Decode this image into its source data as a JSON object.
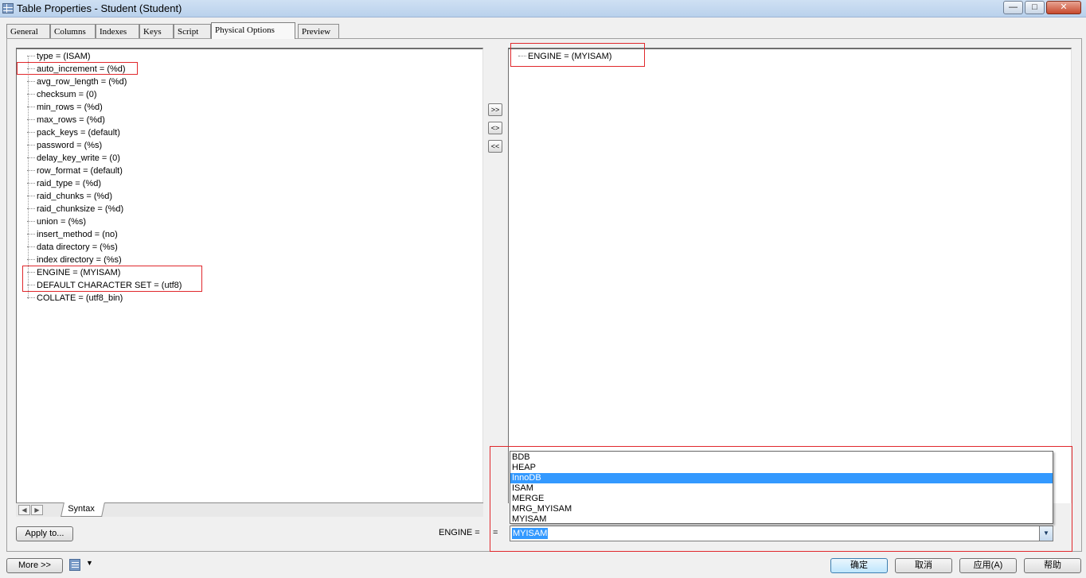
{
  "window": {
    "title": "Table Properties - Student (Student)",
    "minimize": "—",
    "maximize": "□",
    "close": "✕"
  },
  "tabs": [
    "General",
    "Columns",
    "Indexes",
    "Keys",
    "Script",
    "Physical Options",
    "Preview"
  ],
  "active_tab": "Physical Options",
  "left_tree": [
    "type = (ISAM)",
    "auto_increment = (%d)",
    "avg_row_length = (%d)",
    "checksum = (0)",
    "min_rows = (%d)",
    "max_rows = (%d)",
    "pack_keys = (default)",
    "password = (%s)",
    "delay_key_write = (0)",
    "row_format = (default)",
    "raid_type = (%d)",
    "raid_chunks = (%d)",
    "raid_chunksize = (%d)",
    "union = (%s)",
    "insert_method = (no)",
    "data directory = (%s)",
    "index directory = (%s)",
    "ENGINE = (MYISAM)",
    "DEFAULT CHARACTER SET = (utf8)",
    "COLLATE = (utf8_bin)"
  ],
  "right_tree": [
    "ENGINE = (MYISAM)"
  ],
  "transfer_buttons": {
    "add": ">>",
    "swap": "<>",
    "remove": "<<"
  },
  "syntax_tab": "Syntax",
  "apply_button": "Apply to...",
  "option_label": "ENGINE =",
  "equals_sign": "=",
  "engine_options": [
    "BDB",
    "HEAP",
    "InnoDB",
    "ISAM",
    "MERGE",
    "MRG_MYISAM",
    "MYISAM"
  ],
  "engine_highlighted": "InnoDB",
  "engine_value": "MYISAM",
  "footer": {
    "more_button": "More >>",
    "ok": "确定",
    "cancel": "取消",
    "apply": "应用(A)",
    "help": "帮助"
  },
  "colors": {
    "selection": "#3399ff",
    "annotation": "#e0282c"
  }
}
